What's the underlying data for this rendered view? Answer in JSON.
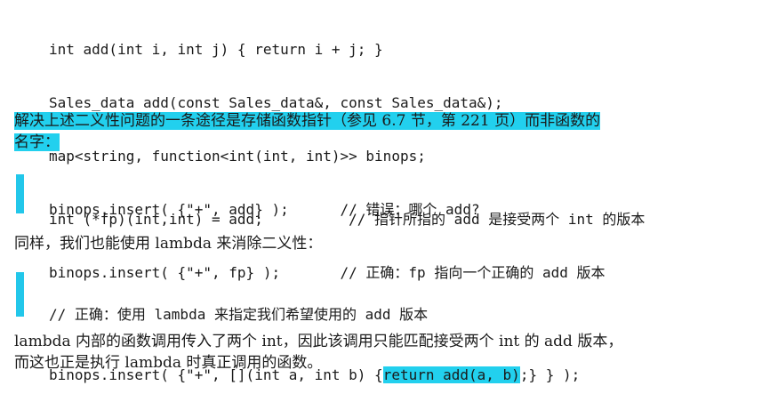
{
  "code_block_1": [
    "int add(int i, int j) { return i + j; }",
    "Sales_data add(const Sales_data&, const Sales_data&);",
    "map<string, function<int(int, int)>> binops;",
    "binops.insert( {\"+\", add} );      // 错误：哪个 add?"
  ],
  "paragraph_1": {
    "line1": "解决上述二义性问题的一条途径是存储函数指针（参见 6.7 节，第 221 页）而非函数的",
    "line2": "名字："
  },
  "code_block_2": [
    "int (*fp)(int,int) = add;          // 指针所指的 add 是接受两个 int 的版本",
    "binops.insert( {\"+\", fp} );       // 正确：fp 指向一个正确的 add 版本"
  ],
  "paragraph_2": "同样，我们也能使用 lambda 来消除二义性：",
  "code_block_3": {
    "comment": "// 正确：使用 lambda 来指定我们希望使用的 add 版本",
    "line_prefix": "binops.insert( {\"+\", [](int a, int b) {",
    "line_highlight": "return add(a, b)",
    "line_suffix": ";} } );"
  },
  "paragraph_3": {
    "line1": "lambda 内部的函数调用传入了两个 int，因此该调用只能匹配接受两个 int 的 add 版本，",
    "line2": "而这也正是执行 lambda 时真正调用的函数。"
  },
  "colors": {
    "highlight": "#22d0ee",
    "margin_bar": "#22c7ea"
  }
}
